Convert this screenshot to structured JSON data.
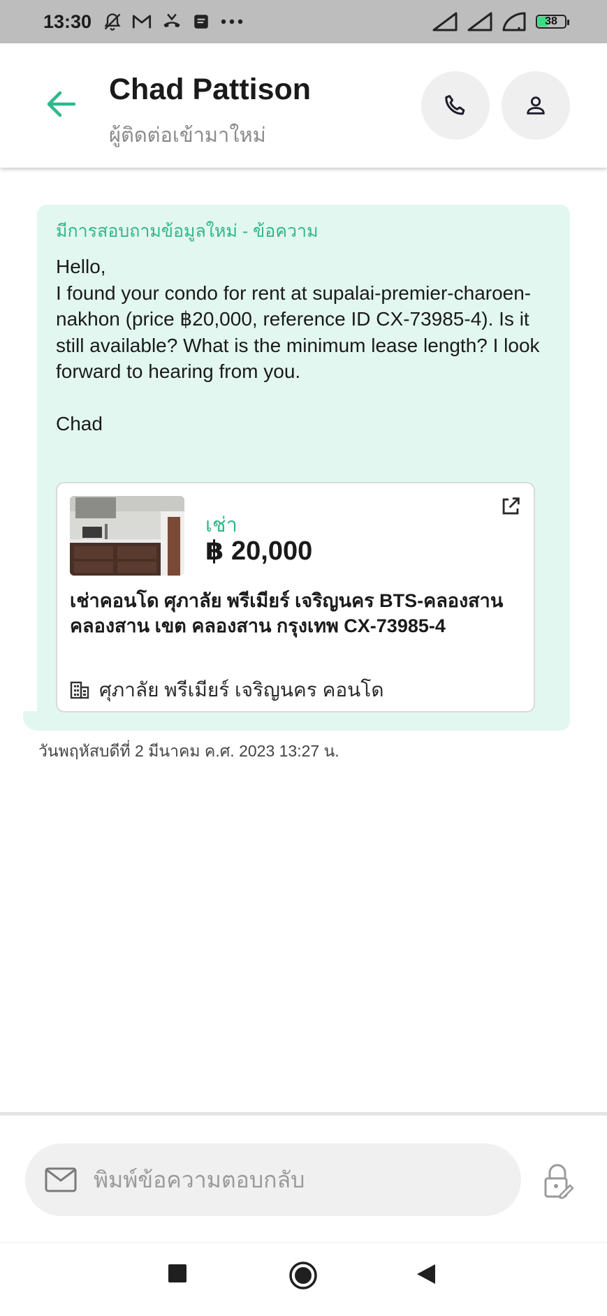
{
  "status_bar": {
    "time": "13:30",
    "battery": "38",
    "left_icons": [
      "muted-bell-icon",
      "gmail-icon",
      "missed-call-icon",
      "message-icon",
      "more-dots-icon"
    ],
    "right_icons": [
      "signal-icon",
      "signal-icon",
      "wifi-icon",
      "battery-icon"
    ]
  },
  "header": {
    "title": "Chad Pattison",
    "subtitle": "ผู้ติดต่อเข้ามาใหม่",
    "icons": [
      "back-arrow-icon",
      "phone-icon",
      "person-icon"
    ]
  },
  "message": {
    "subject": "มีการสอบถามข้อมูลใหม่ - ข้อความ",
    "body": "Hello,\nI found your condo for rent at supalai-premier-charoen-nakhon (price ฿20,000, reference ID CX-73985-4). Is it still available? What is the minimum lease length? I look forward to hearing from you.\n\nChad",
    "timestamp": "วันพฤหัสบดีที่ 2 มีนาคม ค.ศ. 2023 13:27 น."
  },
  "listing": {
    "type": "เช่า",
    "price": "฿ 20,000",
    "title": "เช่าคอนโด  ศุภาลัย พรีเมียร์ เจริญนคร BTS-คลองสาน คลองสาน เขต คลองสาน กรุงเทพ CX-73985-4",
    "project": "ศุภาลัย พรีเมียร์ เจริญนคร คอนโด",
    "icons": [
      "open-external-icon",
      "building-icon"
    ]
  },
  "composer": {
    "placeholder": "พิมพ์ข้อความตอบกลับ",
    "icons": [
      "mail-icon",
      "lock-edit-icon"
    ]
  },
  "nav": {
    "icons": [
      "recents-square-icon",
      "home-circle-icon",
      "back-triangle-icon"
    ]
  },
  "colors": {
    "accent": "#2fb889",
    "bubble": "#e3f7f1",
    "status_bar": "#bdbdbd"
  }
}
